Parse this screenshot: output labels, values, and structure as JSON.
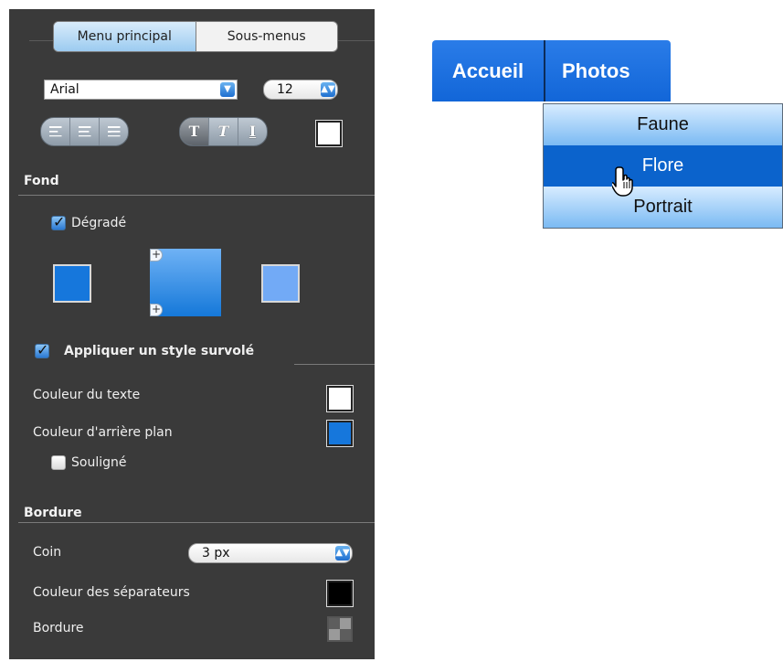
{
  "tabs": {
    "main": "Menu principal",
    "sub": "Sous-menus"
  },
  "font": {
    "family": "Arial",
    "size": "12"
  },
  "align_icons": [
    "align-left-icon",
    "align-center-icon",
    "align-right-icon"
  ],
  "style_icons": {
    "bold": "T",
    "italic": "T",
    "underline": "I"
  },
  "fond": {
    "title": "Fond",
    "gradient_label": "Dégradé",
    "color_start": "#1677dc",
    "color_end": "#72aaf6"
  },
  "hover": {
    "title": "Appliquer un style survolé",
    "text_color_label": "Couleur du texte",
    "bg_color_label": "Couleur d'arrière plan",
    "underline_label": "Souligné",
    "text_color": "#ffffff",
    "bg_color": "#1677dc"
  },
  "bordure": {
    "title": "Bordure",
    "corner_label": "Coin",
    "corner_value": "3 px",
    "separator_label": "Couleur des séparateurs",
    "separator_color": "#000000",
    "border_label": "Bordure"
  },
  "menu": {
    "items": [
      "Accueil",
      "Photos"
    ],
    "submenu": [
      "Faune",
      "Flore",
      "Portrait"
    ]
  }
}
